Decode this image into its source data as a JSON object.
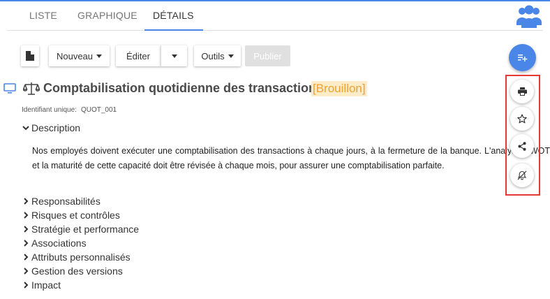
{
  "tabs": [
    {
      "label": "LISTE"
    },
    {
      "label": "GRAPHIQUE"
    },
    {
      "label": "DÉTAILS",
      "active": true
    }
  ],
  "toolbar": {
    "nouveau_label": "Nouveau",
    "editer_label": "Éditer",
    "outils_label": "Outils",
    "publier_label": "Publier"
  },
  "record": {
    "title": "Comptabilisation quotidienne des transactions",
    "status": "[Brouillon]",
    "uid_label": "Identifiant unique:",
    "uid_value": "QUOT_001"
  },
  "description": {
    "heading": "Description",
    "text": "Nos employés doivent exécuter une comptabilisation des transactions à chaque jours, à la fermeture de la banque. L'analyse SWOT et la maturité de cette capacité doit être révisée à chaque mois, pour assurer une comptabilisation parfaite."
  },
  "sections": [
    {
      "label": "Responsabilités"
    },
    {
      "label": "Risques et contrôles"
    },
    {
      "label": "Stratégie et performance"
    },
    {
      "label": "Associations"
    },
    {
      "label": "Attributs personnalisés"
    },
    {
      "label": "Gestion des versions"
    },
    {
      "label": "Impact"
    }
  ],
  "colors": {
    "accent": "#4a86e8",
    "status_bg": "#fdecc8",
    "status_text": "#f0a030",
    "highlight": "#e53935"
  },
  "icons": {
    "users": "users-icon",
    "document": "document-icon",
    "monitor": "monitor-icon",
    "balance": "balance-scale-icon",
    "add_list": "playlist-add-icon",
    "print": "print-icon",
    "star": "star-icon",
    "share": "share-icon",
    "notifications_off": "bell-off-icon"
  }
}
